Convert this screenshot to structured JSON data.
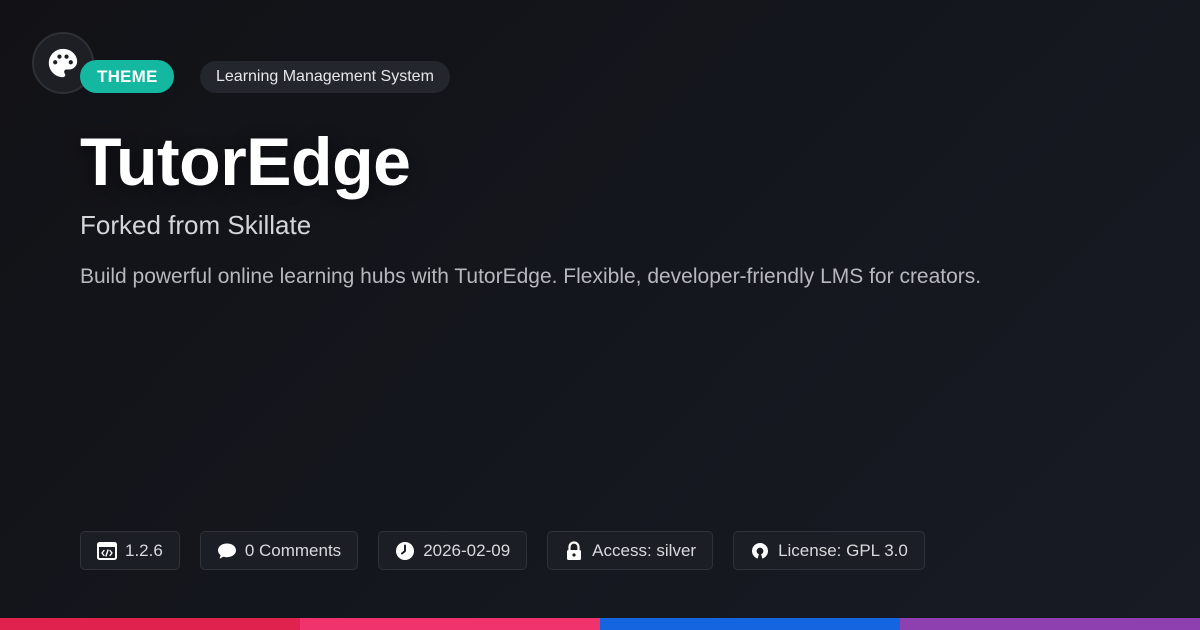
{
  "badge": {
    "type_label": "THEME",
    "category_label": "Learning Management System"
  },
  "header": {
    "title": "TutorEdge",
    "subtitle": "Forked from Skillate",
    "description": "Build powerful online learning hubs with TutorEdge. Flexible, developer-friendly LMS for creators."
  },
  "meta": {
    "version": "1.2.6",
    "comments": "0 Comments",
    "date": "2026-02-09",
    "access": "Access: silver",
    "license": "License: GPL 3.0"
  },
  "icons": {
    "logo": "palette-icon",
    "version": "code-icon",
    "comments": "comment-icon",
    "date": "clock-icon",
    "access": "lock-icon",
    "license": "open-source-icon"
  },
  "colors": {
    "theme_badge": "#14b8a0",
    "bar": [
      "#e0234e",
      "#f0336c",
      "#1565e0",
      "#8e3fb0"
    ]
  }
}
